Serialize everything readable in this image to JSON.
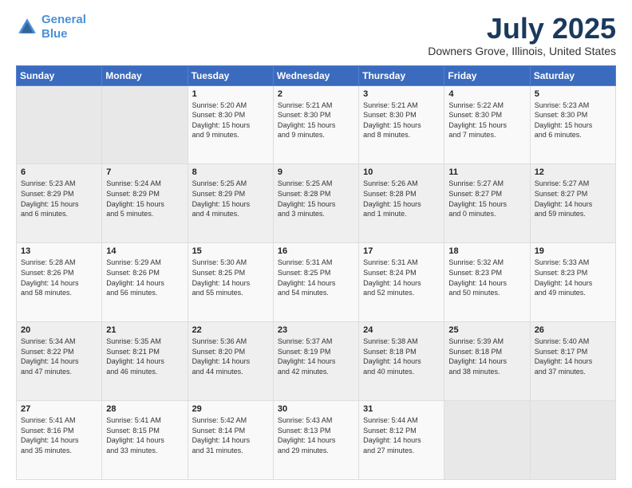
{
  "logo": {
    "line1": "General",
    "line2": "Blue"
  },
  "title": "July 2025",
  "subtitle": "Downers Grove, Illinois, United States",
  "days_header": [
    "Sunday",
    "Monday",
    "Tuesday",
    "Wednesday",
    "Thursday",
    "Friday",
    "Saturday"
  ],
  "weeks": [
    [
      {
        "day": "",
        "content": ""
      },
      {
        "day": "",
        "content": ""
      },
      {
        "day": "1",
        "content": "Sunrise: 5:20 AM\nSunset: 8:30 PM\nDaylight: 15 hours\nand 9 minutes."
      },
      {
        "day": "2",
        "content": "Sunrise: 5:21 AM\nSunset: 8:30 PM\nDaylight: 15 hours\nand 9 minutes."
      },
      {
        "day": "3",
        "content": "Sunrise: 5:21 AM\nSunset: 8:30 PM\nDaylight: 15 hours\nand 8 minutes."
      },
      {
        "day": "4",
        "content": "Sunrise: 5:22 AM\nSunset: 8:30 PM\nDaylight: 15 hours\nand 7 minutes."
      },
      {
        "day": "5",
        "content": "Sunrise: 5:23 AM\nSunset: 8:30 PM\nDaylight: 15 hours\nand 6 minutes."
      }
    ],
    [
      {
        "day": "6",
        "content": "Sunrise: 5:23 AM\nSunset: 8:29 PM\nDaylight: 15 hours\nand 6 minutes."
      },
      {
        "day": "7",
        "content": "Sunrise: 5:24 AM\nSunset: 8:29 PM\nDaylight: 15 hours\nand 5 minutes."
      },
      {
        "day": "8",
        "content": "Sunrise: 5:25 AM\nSunset: 8:29 PM\nDaylight: 15 hours\nand 4 minutes."
      },
      {
        "day": "9",
        "content": "Sunrise: 5:25 AM\nSunset: 8:28 PM\nDaylight: 15 hours\nand 3 minutes."
      },
      {
        "day": "10",
        "content": "Sunrise: 5:26 AM\nSunset: 8:28 PM\nDaylight: 15 hours\nand 1 minute."
      },
      {
        "day": "11",
        "content": "Sunrise: 5:27 AM\nSunset: 8:27 PM\nDaylight: 15 hours\nand 0 minutes."
      },
      {
        "day": "12",
        "content": "Sunrise: 5:27 AM\nSunset: 8:27 PM\nDaylight: 14 hours\nand 59 minutes."
      }
    ],
    [
      {
        "day": "13",
        "content": "Sunrise: 5:28 AM\nSunset: 8:26 PM\nDaylight: 14 hours\nand 58 minutes."
      },
      {
        "day": "14",
        "content": "Sunrise: 5:29 AM\nSunset: 8:26 PM\nDaylight: 14 hours\nand 56 minutes."
      },
      {
        "day": "15",
        "content": "Sunrise: 5:30 AM\nSunset: 8:25 PM\nDaylight: 14 hours\nand 55 minutes."
      },
      {
        "day": "16",
        "content": "Sunrise: 5:31 AM\nSunset: 8:25 PM\nDaylight: 14 hours\nand 54 minutes."
      },
      {
        "day": "17",
        "content": "Sunrise: 5:31 AM\nSunset: 8:24 PM\nDaylight: 14 hours\nand 52 minutes."
      },
      {
        "day": "18",
        "content": "Sunrise: 5:32 AM\nSunset: 8:23 PM\nDaylight: 14 hours\nand 50 minutes."
      },
      {
        "day": "19",
        "content": "Sunrise: 5:33 AM\nSunset: 8:23 PM\nDaylight: 14 hours\nand 49 minutes."
      }
    ],
    [
      {
        "day": "20",
        "content": "Sunrise: 5:34 AM\nSunset: 8:22 PM\nDaylight: 14 hours\nand 47 minutes."
      },
      {
        "day": "21",
        "content": "Sunrise: 5:35 AM\nSunset: 8:21 PM\nDaylight: 14 hours\nand 46 minutes."
      },
      {
        "day": "22",
        "content": "Sunrise: 5:36 AM\nSunset: 8:20 PM\nDaylight: 14 hours\nand 44 minutes."
      },
      {
        "day": "23",
        "content": "Sunrise: 5:37 AM\nSunset: 8:19 PM\nDaylight: 14 hours\nand 42 minutes."
      },
      {
        "day": "24",
        "content": "Sunrise: 5:38 AM\nSunset: 8:18 PM\nDaylight: 14 hours\nand 40 minutes."
      },
      {
        "day": "25",
        "content": "Sunrise: 5:39 AM\nSunset: 8:18 PM\nDaylight: 14 hours\nand 38 minutes."
      },
      {
        "day": "26",
        "content": "Sunrise: 5:40 AM\nSunset: 8:17 PM\nDaylight: 14 hours\nand 37 minutes."
      }
    ],
    [
      {
        "day": "27",
        "content": "Sunrise: 5:41 AM\nSunset: 8:16 PM\nDaylight: 14 hours\nand 35 minutes."
      },
      {
        "day": "28",
        "content": "Sunrise: 5:41 AM\nSunset: 8:15 PM\nDaylight: 14 hours\nand 33 minutes."
      },
      {
        "day": "29",
        "content": "Sunrise: 5:42 AM\nSunset: 8:14 PM\nDaylight: 14 hours\nand 31 minutes."
      },
      {
        "day": "30",
        "content": "Sunrise: 5:43 AM\nSunset: 8:13 PM\nDaylight: 14 hours\nand 29 minutes."
      },
      {
        "day": "31",
        "content": "Sunrise: 5:44 AM\nSunset: 8:12 PM\nDaylight: 14 hours\nand 27 minutes."
      },
      {
        "day": "",
        "content": ""
      },
      {
        "day": "",
        "content": ""
      }
    ]
  ]
}
